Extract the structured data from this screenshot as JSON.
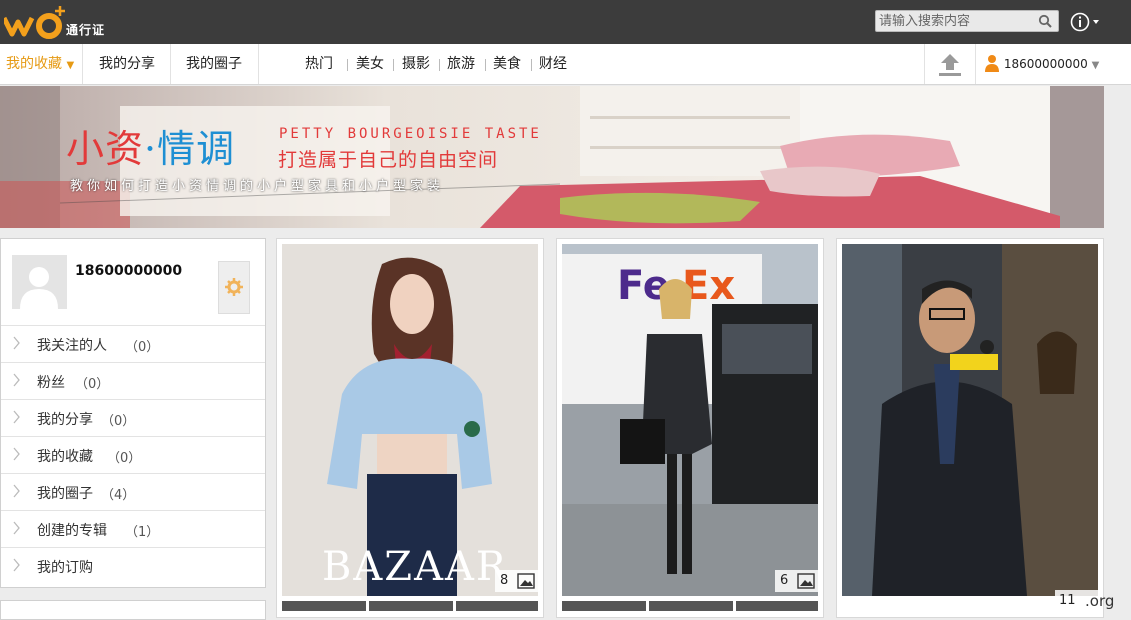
{
  "topbar": {
    "logo_text": "通行证",
    "search_placeholder": "请输入搜索内容"
  },
  "nav": {
    "tabs": [
      {
        "label": "我的收藏",
        "active": true
      },
      {
        "label": "我的分享",
        "active": false
      },
      {
        "label": "我的圈子",
        "active": false
      }
    ],
    "categories": [
      "热门",
      "美女",
      "摄影",
      "旅游",
      "美食",
      "财经"
    ],
    "user": "18600000000"
  },
  "banner": {
    "title_red": "小资",
    "title_dot": "·",
    "title_blue": "情调",
    "title_en": "PETTY BOURGEOISIE TASTE",
    "title_cn": "打造属于自己的自由空间",
    "subtitle": "教你如何打造小资情调的小户型家具和小户型家装"
  },
  "sidebar": {
    "username": "18600000000",
    "menu": [
      {
        "label": "我关注的人",
        "count": "（0）"
      },
      {
        "label": "粉丝",
        "count": "（0）"
      },
      {
        "label": "我的分享",
        "count": "（0）"
      },
      {
        "label": "我的收藏",
        "count": "（0）"
      },
      {
        "label": "我的圈子",
        "count": "（4）"
      },
      {
        "label": "创建的专辑",
        "count": "（1）"
      },
      {
        "label": "我的订购",
        "count": ""
      }
    ]
  },
  "cards": [
    {
      "count": "8",
      "caption": "BAZAAR"
    },
    {
      "count": "6",
      "caption": ""
    },
    {
      "count": "11",
      "caption": ""
    }
  ],
  "watermark": ".org",
  "colors": {
    "accent": "#e69a14",
    "topbar": "#3c3c3c"
  }
}
